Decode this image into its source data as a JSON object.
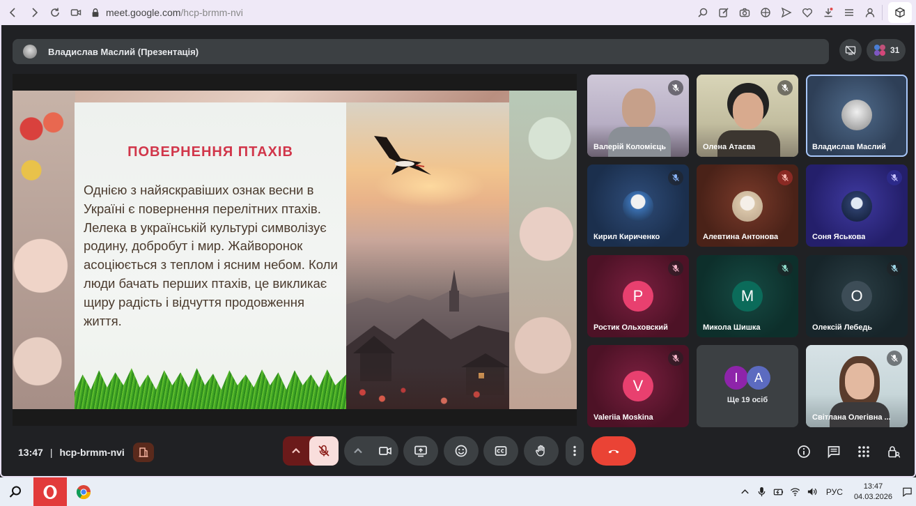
{
  "browser": {
    "url_host": "meet.google.com",
    "url_path": "/hcp-brmm-nvi"
  },
  "meeting": {
    "presenter_label": "Владислав Маслий (Презентація)",
    "people_count": "31",
    "time": "13:47",
    "divider": "|",
    "code": "hcp-brmm-nvi"
  },
  "slide": {
    "title": "ПОВЕРНЕННЯ ПТАХІВ",
    "body": "Однією з найяскравіших ознак весни в Україні є повернення перелітних птахів. Лелека в українській культурі символізує родину, добробут і мир. Жайворонок асоціюється з теплом і ясним небом. Коли люди бачать перших птахів, це викликає щиру радість і відчуття продовження життя."
  },
  "participants": [
    {
      "name": "Валерій Коломієць",
      "type": "video"
    },
    {
      "name": "Олена Атаєва",
      "type": "video"
    },
    {
      "name": "Владислав Маслий",
      "type": "photo"
    },
    {
      "name": "Кирил Кириченко",
      "type": "photo"
    },
    {
      "name": "Алевтина Антонова",
      "type": "photo"
    },
    {
      "name": "Соня Яськова",
      "type": "photo"
    },
    {
      "name": "Ростик Ольховский",
      "type": "letter",
      "letter": "P",
      "color": "#e8406f"
    },
    {
      "name": "Микола Шишка",
      "type": "letter",
      "letter": "M",
      "color": "#0b6b5a"
    },
    {
      "name": "Олексій Лебедь",
      "type": "letter",
      "letter": "O",
      "color": "#3d4d57"
    },
    {
      "name": "Valeriia Moskina",
      "type": "letter",
      "letter": "V",
      "color": "#e8406f"
    },
    {
      "name": "Ще 19 осіб",
      "type": "group",
      "letters": [
        "I",
        "A"
      ]
    },
    {
      "name": "Світлана Олегівна ...",
      "type": "video"
    }
  ],
  "taskbar": {
    "lang": "РУС",
    "time": "13:47",
    "date": "04.03.2026"
  },
  "colors": {
    "meet_bg": "#202124",
    "leave_red": "#ea4335",
    "slide_title": "#d1364a"
  }
}
